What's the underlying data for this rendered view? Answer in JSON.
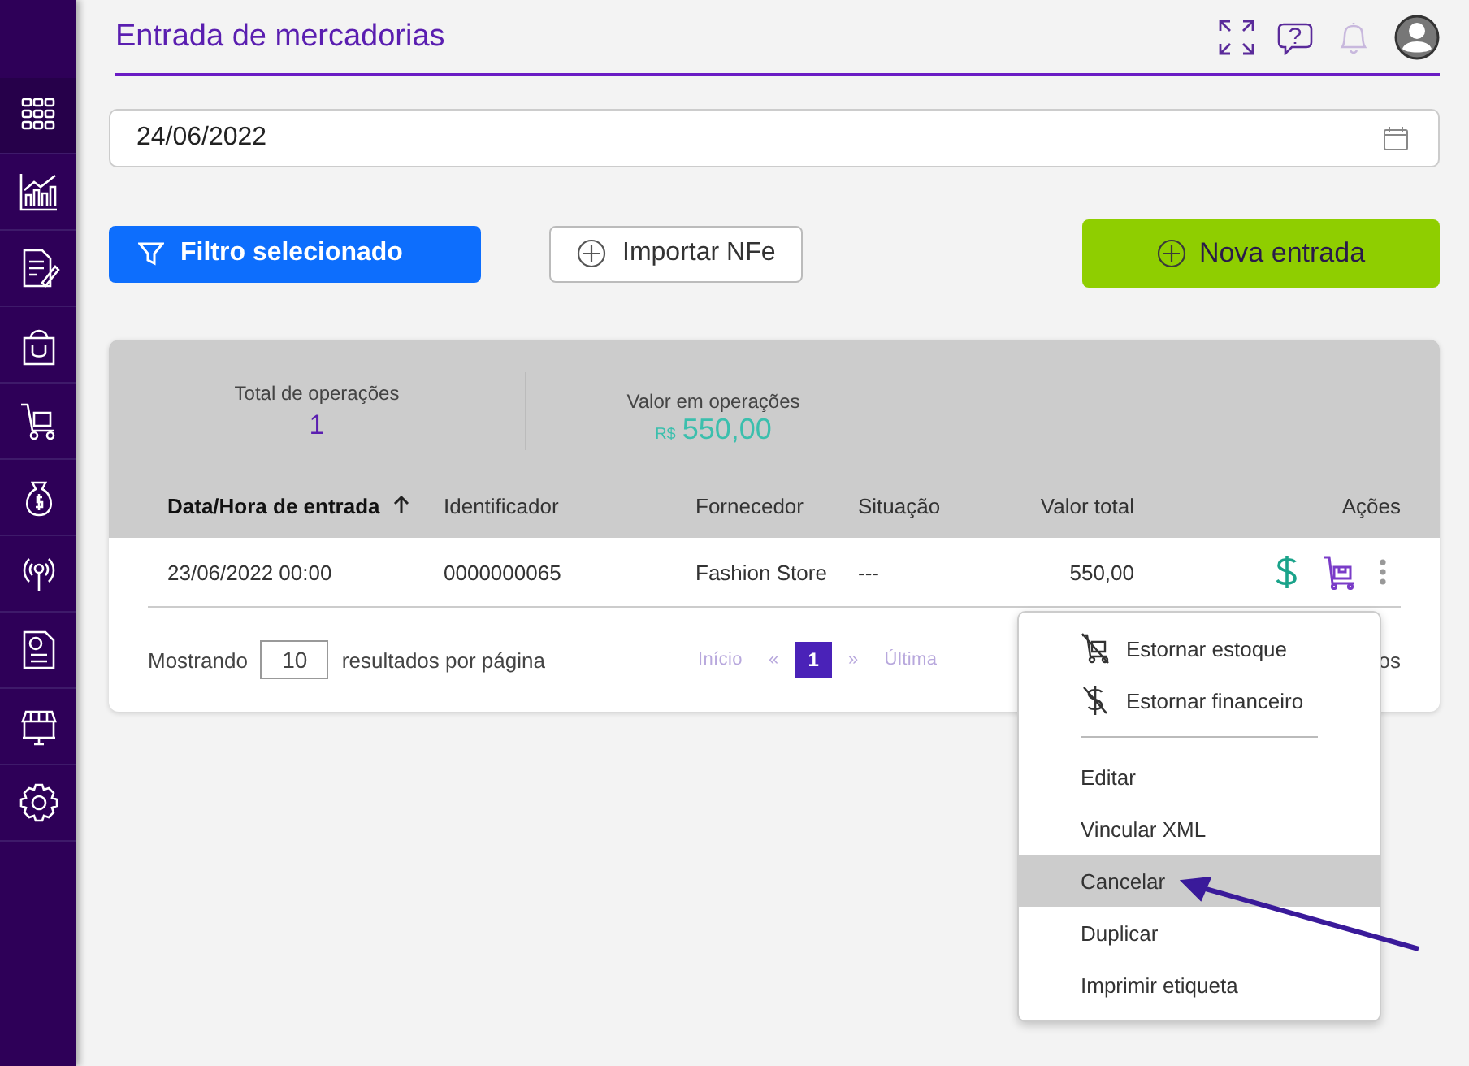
{
  "sidebar": {
    "items": [
      {
        "kind": "apps",
        "selected": true
      },
      {
        "kind": "chart",
        "selected": false
      },
      {
        "kind": "document",
        "selected": false
      },
      {
        "kind": "bag",
        "selected": false
      },
      {
        "kind": "cart",
        "selected": false
      },
      {
        "kind": "money",
        "selected": false
      },
      {
        "kind": "antenna",
        "selected": false
      },
      {
        "kind": "report",
        "selected": false
      },
      {
        "kind": "store",
        "selected": false
      },
      {
        "kind": "settings",
        "selected": false
      }
    ]
  },
  "header": {
    "title": "Entrada de mercadorias"
  },
  "date_field": {
    "value": "24/06/2022"
  },
  "buttons": {
    "filter": "Filtro selecionado",
    "import": "Importar NFe",
    "new": "Nova entrada"
  },
  "summary": {
    "total_label": "Total de operações",
    "total": "1",
    "value_label": "Valor em operações",
    "currency": "R$",
    "value": "550,00"
  },
  "table": {
    "columns": [
      {
        "label": "Data/Hora de entrada",
        "sorted": true
      },
      {
        "label": "Identificador",
        "sorted": false
      },
      {
        "label": "Fornecedor",
        "sorted": false
      },
      {
        "label": "Situação",
        "sorted": false
      },
      {
        "label": "Valor total",
        "sorted": false
      },
      {
        "label": "Ações",
        "sorted": false
      }
    ],
    "rows": [
      {
        "date": "23/06/2022 00:00",
        "id": "0000000065",
        "supplier": "Fashion Store",
        "status": "---",
        "total": "550,00"
      }
    ]
  },
  "footer": {
    "showing": "Mostrando",
    "page_size": "10",
    "per_page": "resultados por página",
    "pages": [
      {
        "kind": "nav",
        "label": "Início",
        "selected": false
      },
      {
        "kind": "nav",
        "label": "«",
        "selected": false
      },
      {
        "kind": "page",
        "label": "1",
        "selected": true
      },
      {
        "kind": "nav",
        "label": "»",
        "selected": false
      },
      {
        "kind": "nav",
        "label": "Última",
        "selected": false
      }
    ],
    "records_tail": "os"
  },
  "menu": {
    "items": [
      {
        "kind": "icon-action",
        "label": "Estornar estoque",
        "selected": false
      },
      {
        "kind": "icon-action",
        "label": "Estornar financeiro",
        "selected": false
      },
      {
        "kind": "action",
        "label": "Editar",
        "selected": false
      },
      {
        "kind": "action",
        "label": "Vincular XML",
        "selected": false
      },
      {
        "kind": "action",
        "label": "Cancelar",
        "selected": true
      },
      {
        "kind": "action",
        "label": "Duplicar",
        "selected": false
      },
      {
        "kind": "action",
        "label": "Imprimir etiqueta",
        "selected": false
      }
    ]
  }
}
